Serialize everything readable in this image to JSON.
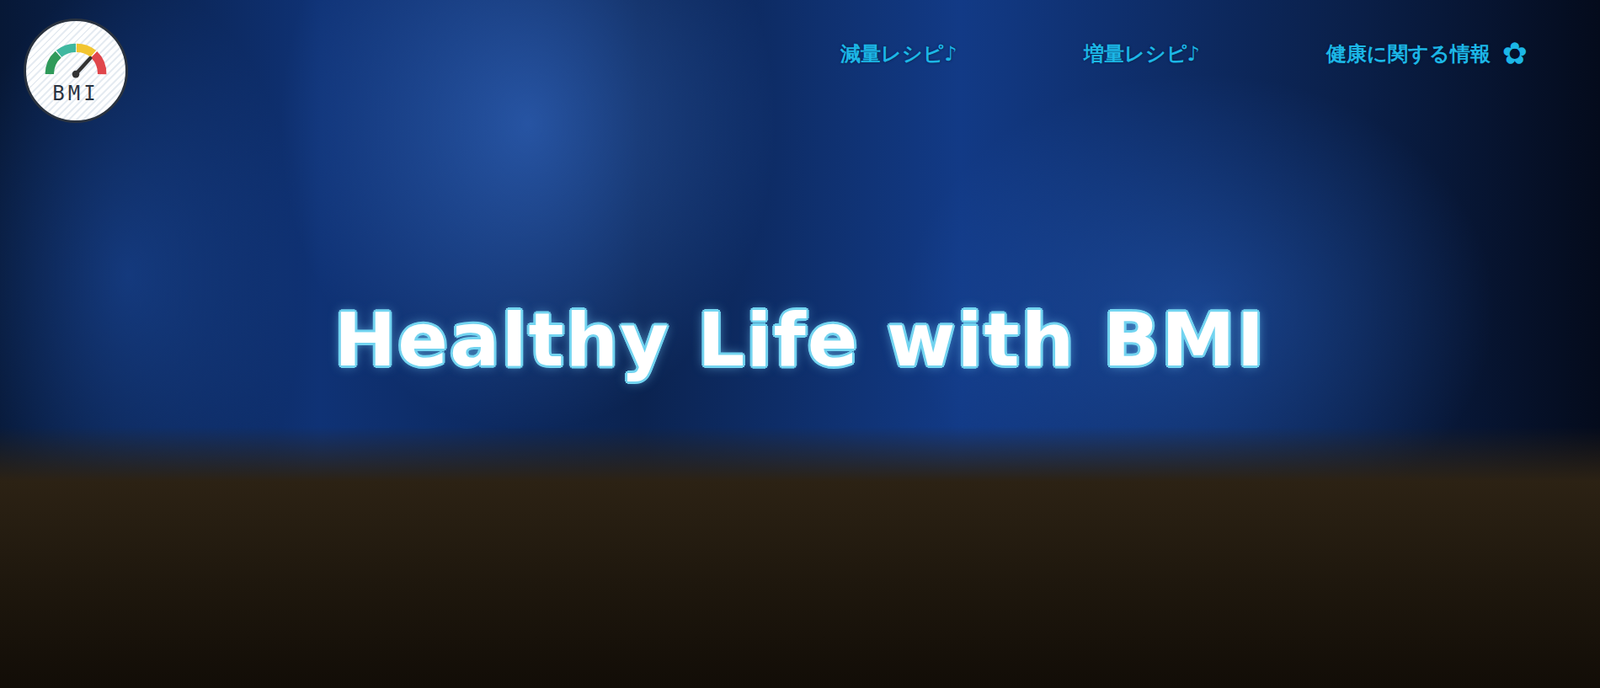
{
  "logo": {
    "label": "BMI"
  },
  "nav": {
    "items": [
      {
        "label": "減量レシピ♪",
        "icon": ""
      },
      {
        "label": "増量レシピ♪",
        "icon": ""
      },
      {
        "label": "健康に関する情報",
        "icon": "✿"
      }
    ]
  },
  "hero": {
    "title": "Healthy Life with BMI"
  }
}
